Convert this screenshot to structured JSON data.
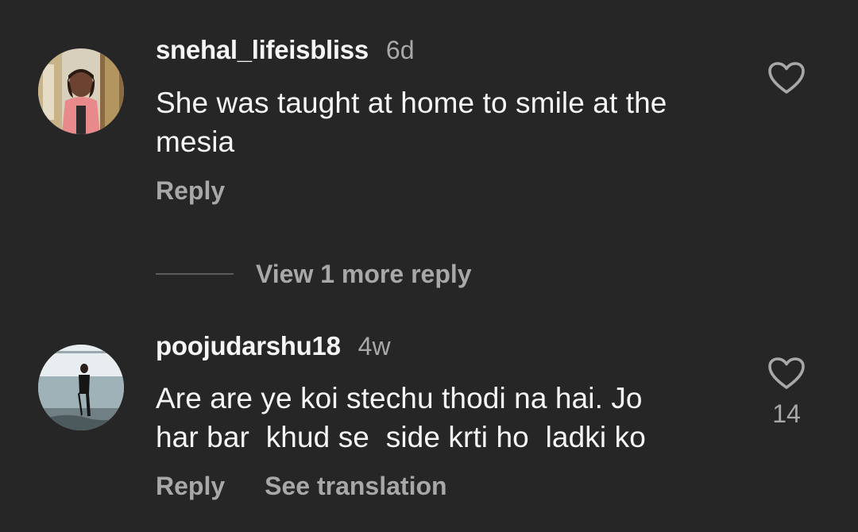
{
  "comments": [
    {
      "username": "snehal_lifeisbliss",
      "age": "6d",
      "text": "She was taught at home to smile at the\nmesia",
      "reply_label": "Reply",
      "like_icon": "heart-outline-icon"
    },
    {
      "username": "poojudarshu18",
      "age": "4w",
      "text": "Are are ye koi stechu thodi na hai. Jo\nhar bar  khud se  side krti ho  ladki ko",
      "reply_label": "Reply",
      "translate_label": "See translation",
      "like_count": "14",
      "like_icon": "heart-outline-icon"
    }
  ],
  "view_replies": {
    "label": "View 1 more reply"
  },
  "colors": {
    "background": "#262626",
    "primary_text": "#f5f5f5",
    "secondary_text": "#a8a8a8"
  }
}
